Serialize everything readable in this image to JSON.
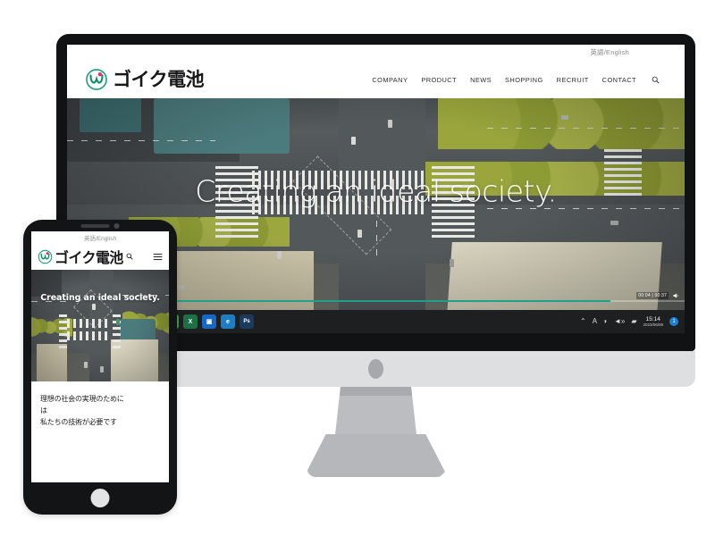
{
  "site": {
    "lang_toggle": "英語/English",
    "brand_name": "ゴイク電池",
    "logo_icon": "circle-w-mark-logo",
    "nav": [
      {
        "label": "COMPANY"
      },
      {
        "label": "PRODUCT"
      },
      {
        "label": "NEWS"
      },
      {
        "label": "SHOPPING"
      },
      {
        "label": "RECRUIT"
      },
      {
        "label": "CONTACT"
      }
    ],
    "search_icon": "search-icon",
    "hero": {
      "headline": "Creating an ideal society.",
      "background": "aerial-city-intersection-video",
      "video_time": "00:04 | 00:37",
      "volume_icon": "speaker-icon",
      "progress_percent": 88
    }
  },
  "phone": {
    "lang_toggle": "英語/English",
    "brand_name": "ゴイク電池",
    "search_icon": "search-icon",
    "menu_icon": "hamburger-menu-icon",
    "hero_headline": "Creating an ideal society.",
    "copy_lines": [
      "理想の社会の実現のために",
      "は",
      "私たちの技術が必要です"
    ]
  },
  "taskbar": {
    "apps": [
      {
        "name": "cortana-icon",
        "glyph": "◐",
        "color": "#1f6fb2"
      },
      {
        "name": "chrome-icon",
        "glyph": "◉",
        "color": "#e8453c"
      },
      {
        "name": "mail-icon",
        "glyph": "✉",
        "color": "#1aa3d8"
      },
      {
        "name": "file-explorer-icon",
        "glyph": "▰",
        "color": "#e8b23a"
      },
      {
        "name": "edge-icon",
        "glyph": "e",
        "color": "#1f7ec2"
      },
      {
        "name": "chrome-profile-icon",
        "glyph": "◉",
        "color": "#3aa04a"
      },
      {
        "name": "excel-icon",
        "glyph": "X",
        "color": "#1d7044"
      },
      {
        "name": "onedrive-icon",
        "glyph": "▣",
        "color": "#1668c4"
      },
      {
        "name": "edge-secondary-icon",
        "glyph": "e",
        "color": "#1f7ec2"
      },
      {
        "name": "photoshop-icon",
        "glyph": "Ps",
        "color": "#1b3a5c"
      }
    ],
    "tray": {
      "chevron_icon": "chevron-up-icon",
      "ime_icon": "A",
      "wifi_icon": "wifi-icon",
      "volume_icon": "volume-icon",
      "network_icon": "network-icon",
      "clock_time": "15:14",
      "clock_date": "2023/06/09",
      "notification_count": "1"
    }
  },
  "colors": {
    "brand_green": "#1ea08a",
    "brand_accent_pink": "#e0336c",
    "text_dark": "#18181a",
    "taskbar_bg": "#1d1f21",
    "device_frame": "#131416",
    "chin_gray": "#dedfe1"
  }
}
